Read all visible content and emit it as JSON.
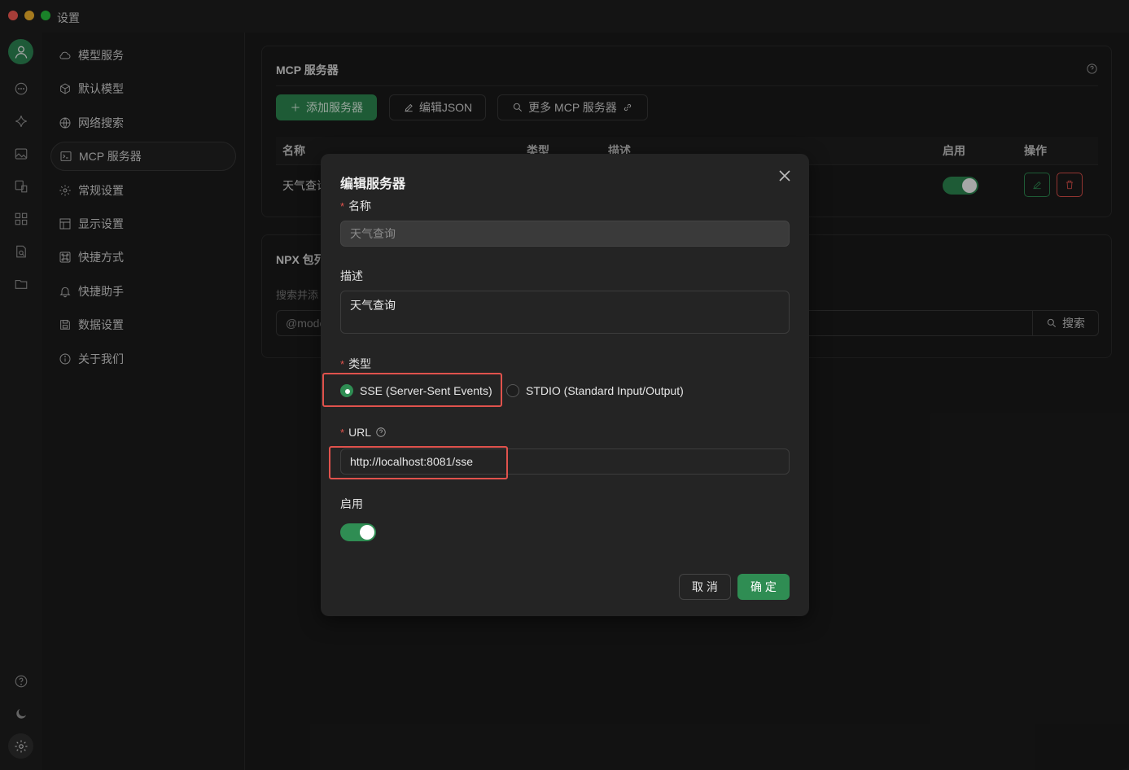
{
  "window": {
    "title": "设置"
  },
  "rail": {
    "icons": [
      "avatar-icon",
      "chat-icon",
      "sparkle-icon",
      "image-icon",
      "translate-icon",
      "apps-icon",
      "doc-search-icon",
      "folder-icon"
    ],
    "bottom": [
      "help-icon",
      "moon-icon",
      "gear-icon"
    ]
  },
  "sidebar": {
    "items": [
      {
        "label": "模型服务",
        "icon": "cloud-icon"
      },
      {
        "label": "默认模型",
        "icon": "cube-icon"
      },
      {
        "label": "网络搜索",
        "icon": "globe-icon"
      },
      {
        "label": "MCP 服务器",
        "icon": "terminal-icon"
      },
      {
        "label": "常规设置",
        "icon": "gear-icon"
      },
      {
        "label": "显示设置",
        "icon": "layout-icon"
      },
      {
        "label": "快捷方式",
        "icon": "command-icon"
      },
      {
        "label": "快捷助手",
        "icon": "bell-icon"
      },
      {
        "label": "数据设置",
        "icon": "save-icon"
      },
      {
        "label": "关于我们",
        "icon": "info-icon"
      }
    ],
    "active_index": 3
  },
  "mcp": {
    "title": "MCP 服务器",
    "add_button": "添加服务器",
    "edit_json_button": "编辑JSON",
    "more_button": "更多 MCP 服务器",
    "columns": [
      "名称",
      "类型",
      "描述",
      "启用",
      "操作"
    ],
    "row_name": "天气查询"
  },
  "npx": {
    "title": "NPX 包列",
    "hint": "搜索并添",
    "search_placeholder": "@mode",
    "search_button": "搜索"
  },
  "modal": {
    "title": "编辑服务器",
    "name_label": "名称",
    "name_value": "天气查询",
    "desc_label": "描述",
    "desc_value": "天气查询",
    "type_label": "类型",
    "type_options": [
      "SSE (Server-Sent Events)",
      "STDIO (Standard Input/Output)"
    ],
    "type_selected": "SSE (Server-Sent Events)",
    "url_label": "URL",
    "url_value": "http://localhost:8081/sse",
    "enabled_label": "启用",
    "enabled": true,
    "cancel": "取 消",
    "ok": "确 定"
  },
  "colors": {
    "accent": "#2f8d53",
    "danger": "#e0524c",
    "bg": "#1b1b1b",
    "modal_bg": "#242424"
  }
}
